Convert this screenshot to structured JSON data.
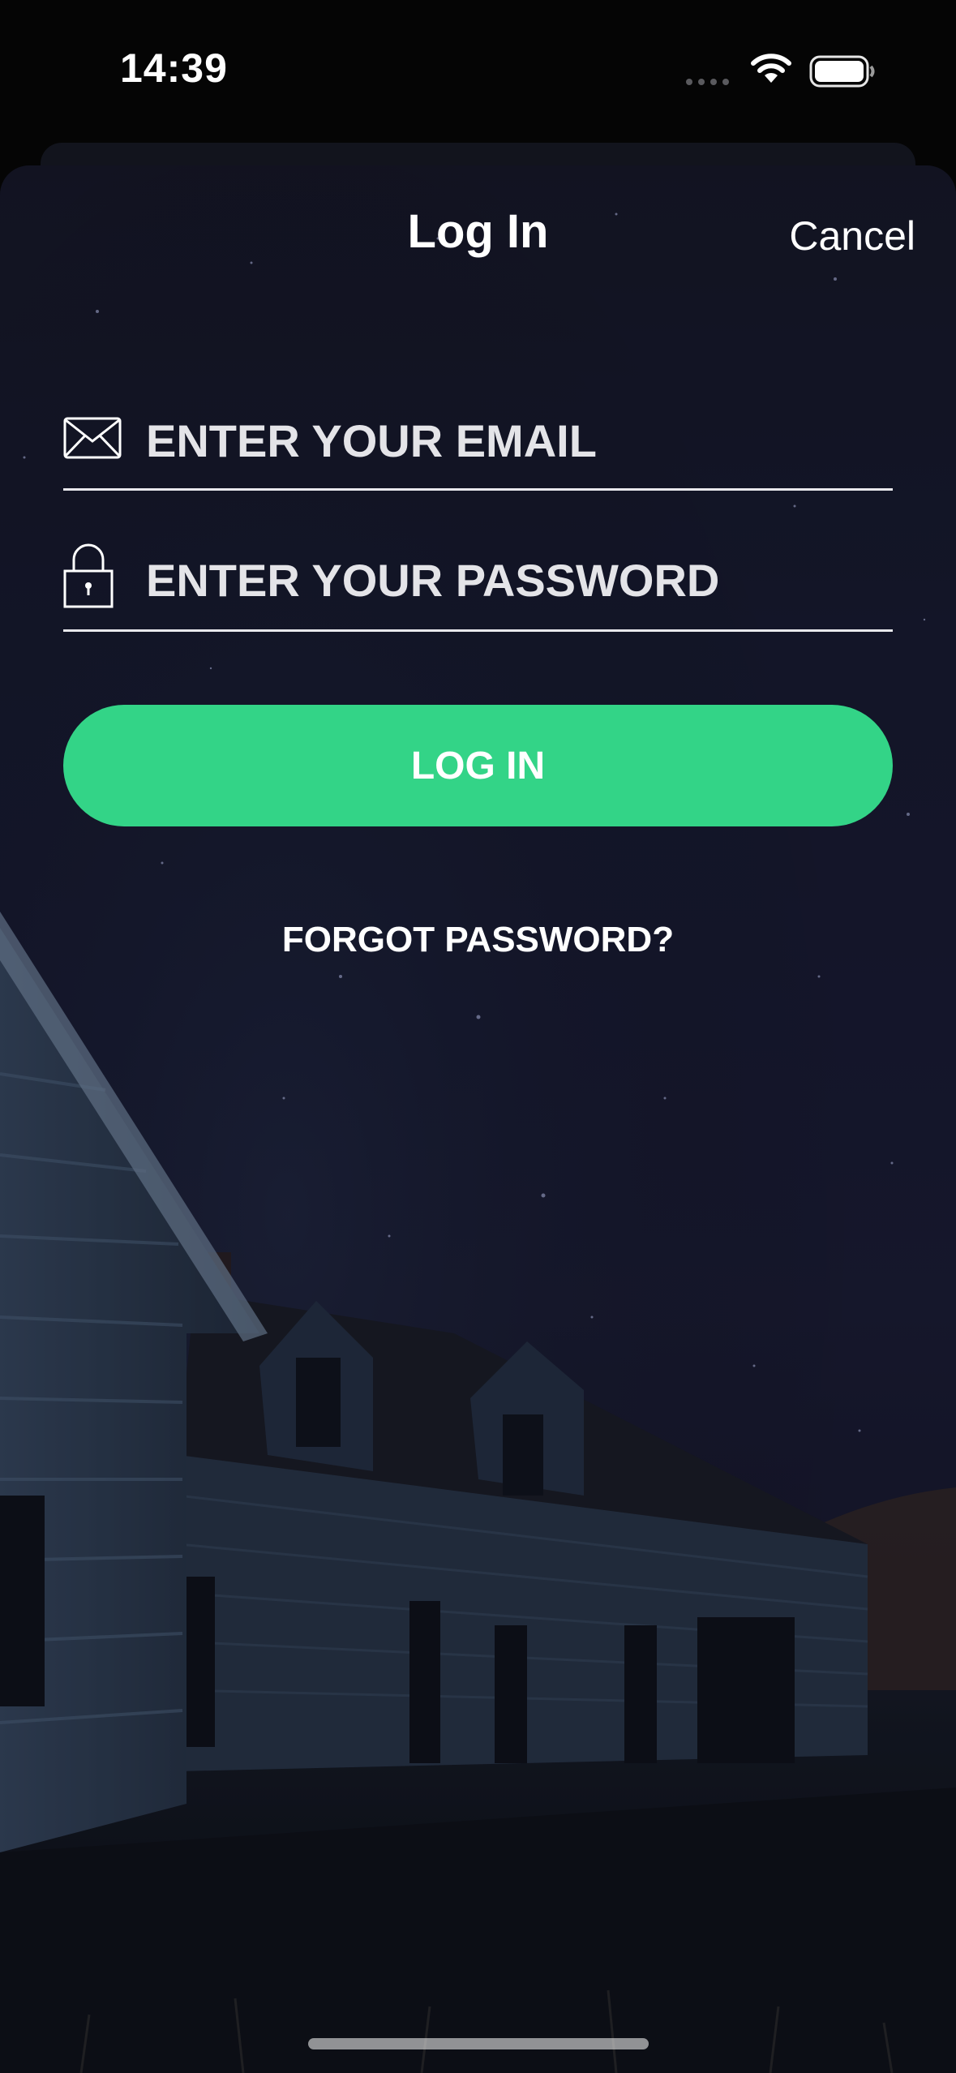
{
  "status_bar": {
    "time": "14:39"
  },
  "nav": {
    "title": "Log In",
    "cancel_label": "Cancel"
  },
  "form": {
    "email_placeholder": "ENTER YOUR EMAIL",
    "email_value": "",
    "password_placeholder": "ENTER YOUR PASSWORD",
    "password_value": "",
    "login_label": "LOG IN",
    "forgot_label": "FORGOT PASSWORD?"
  },
  "icons": {
    "email": "envelope-icon",
    "password": "lock-icon",
    "wifi": "wifi-icon",
    "battery": "battery-icon"
  },
  "colors": {
    "accent": "#33d487",
    "background": "#161a2e",
    "text": "#ffffff"
  }
}
